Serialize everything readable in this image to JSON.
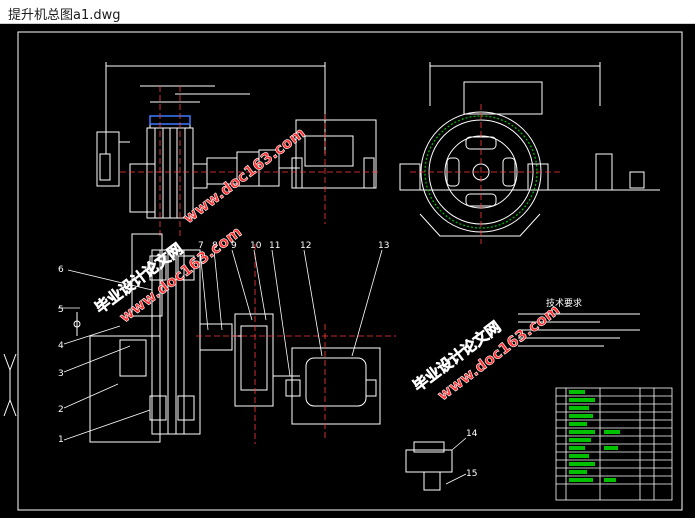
{
  "window": {
    "title": "提升机总图a1.dwg"
  },
  "balloons": [
    "1",
    "2",
    "3",
    "4",
    "5",
    "6",
    "7",
    "8",
    "9",
    "10",
    "11",
    "12",
    "13",
    "14",
    "15"
  ],
  "notes": {
    "heading": "技术要求"
  },
  "watermarks": {
    "line1": "毕业设计论文网",
    "line2": "www.doc163.com"
  },
  "colors": {
    "background": "#000000",
    "linework": "#ffffff",
    "dimension": "#ff3b3b",
    "accent": "#00c000",
    "watermark_text": "#ff3030",
    "watermark_outline": "#ffffff"
  }
}
